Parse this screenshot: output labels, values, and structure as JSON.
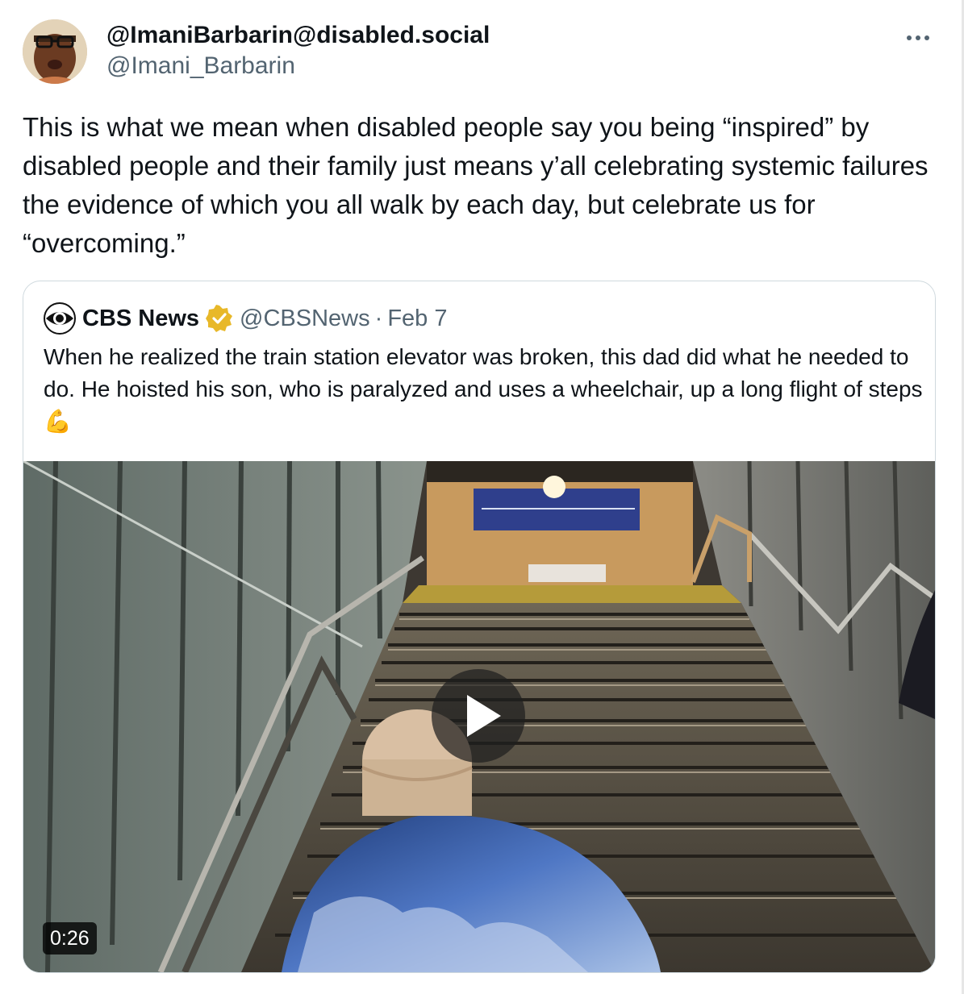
{
  "tweet": {
    "display_name": "@ImaniBarbarin@disabled.social",
    "handle": "@Imani_Barbarin",
    "more_icon": "more-horizontal-icon",
    "text": "This is what we mean when disabled people say you being “inspired” by disabled people and their family just means y’all celebrating systemic failures the evidence of which you all walk by each day, but celebrate us for “overcoming.”"
  },
  "quote": {
    "name": "CBS News",
    "handle": "@CBSNews",
    "separator": "·",
    "date": "Feb 7",
    "text": "When he realized the train station elevator was broken, this dad did what he needed to do. He hoisted his son, who is paralyzed and uses a wheelchair, up a long flight of steps 💪",
    "verified_badge_color": "#e8b829",
    "video": {
      "duration": "0:26",
      "play_icon": "play-icon"
    }
  }
}
